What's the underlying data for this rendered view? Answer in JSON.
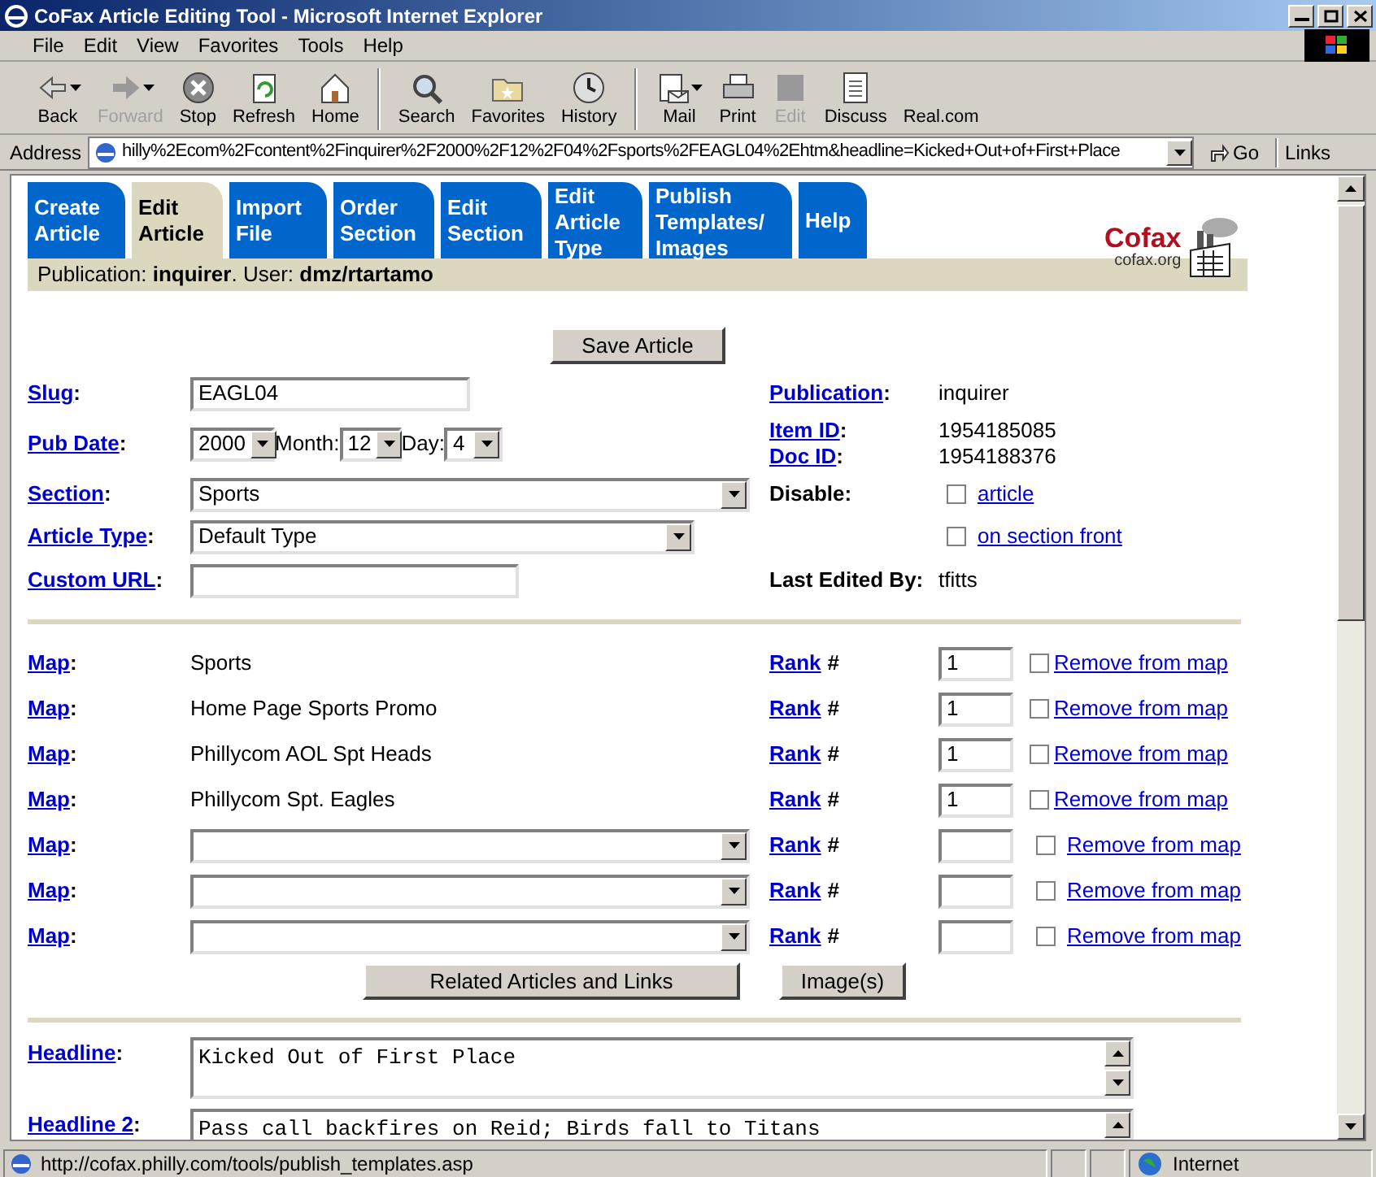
{
  "window": {
    "title": "CoFax Article Editing Tool - Microsoft Internet Explorer"
  },
  "menu": [
    "File",
    "Edit",
    "View",
    "Favorites",
    "Tools",
    "Help"
  ],
  "toolbar": [
    {
      "label": "Back",
      "disabled": false,
      "dropdown": true
    },
    {
      "label": "Forward",
      "disabled": true,
      "dropdown": true
    },
    {
      "label": "Stop",
      "disabled": false,
      "dropdown": false
    },
    {
      "label": "Refresh",
      "disabled": false,
      "dropdown": false
    },
    {
      "label": "Home",
      "disabled": false,
      "dropdown": false
    },
    {
      "label": "Search",
      "disabled": false,
      "dropdown": false
    },
    {
      "label": "Favorites",
      "disabled": false,
      "dropdown": false
    },
    {
      "label": "History",
      "disabled": false,
      "dropdown": false
    },
    {
      "label": "Mail",
      "disabled": false,
      "dropdown": true
    },
    {
      "label": "Print",
      "disabled": false,
      "dropdown": false
    },
    {
      "label": "Edit",
      "disabled": true,
      "dropdown": false
    },
    {
      "label": "Discuss",
      "disabled": false,
      "dropdown": false
    },
    {
      "label": "Real.com",
      "disabled": false,
      "dropdown": false
    }
  ],
  "address": {
    "label": "Address",
    "value": "hilly%2Ecom%2Fcontent%2Finquirer%2F2000%2F12%2F04%2Fsports%2FEAGL04%2Ehtm&headline=Kicked+Out+of+First+Place",
    "go": "Go",
    "links": "Links"
  },
  "tabs": [
    {
      "label": "Create Article",
      "selected": false
    },
    {
      "label": "Edit Article",
      "selected": true
    },
    {
      "label": "Import File",
      "selected": false
    },
    {
      "label": "Order Section",
      "selected": false
    },
    {
      "label": "Edit Section",
      "selected": false
    },
    {
      "label": "Edit Article Type",
      "selected": false
    },
    {
      "label": "Publish Templates/ Images",
      "selected": false
    },
    {
      "label": "Help",
      "selected": false
    }
  ],
  "info_bar": "Publication: **inquirer**. User: **dmz/rtartamo**",
  "logo": {
    "name": "Cofax",
    "site": "cofax.org"
  },
  "save_button": "Save Article",
  "slug": {
    "label": "Slug",
    "after": ":",
    "value": "EAGL04"
  },
  "pub_date": {
    "label": "Pub Date",
    "after": ":",
    "year": "2000",
    "month_label": "Month:",
    "month": "12",
    "day_label": "Day:",
    "day": "4"
  },
  "section": {
    "label": "Section",
    "after": ":",
    "value": "Sports"
  },
  "article_type": {
    "label": "Article Type",
    "after": ":",
    "value": "Default Type"
  },
  "custom_url": {
    "label": "Custom URL",
    "after": ":"
  },
  "publication": {
    "label": "Publication",
    "after": ":",
    "value": "inquirer"
  },
  "item_id": {
    "label": "Item ID",
    "after": ":",
    "value": "1954185085"
  },
  "doc_id": {
    "label": "Doc ID",
    "after": ":",
    "value": "1954188376"
  },
  "disable": {
    "label": "Disable:",
    "options": [
      {
        "label": "article",
        "checked": false
      },
      {
        "label": "on section front",
        "checked": false
      }
    ]
  },
  "last_edited": {
    "label": "Last Edited By:",
    "value": "tfitts"
  },
  "maps": [
    {
      "kind": "fixed",
      "label": "Map",
      "after": ":",
      "value": "Sports",
      "rank_label": "Rank",
      "rank_after": "#",
      "rank": "1",
      "remove": "Remove from map",
      "checked": false
    },
    {
      "kind": "fixed",
      "label": "Map",
      "after": ":",
      "value": "Home Page Sports Promo",
      "rank_label": "Rank",
      "rank_after": "#",
      "rank": "1",
      "remove": "Remove from map",
      "checked": false
    },
    {
      "kind": "fixed",
      "label": "Map",
      "after": ":",
      "value": "Phillycom AOL Spt Heads",
      "rank_label": "Rank",
      "rank_after": "#",
      "rank": "1",
      "remove": "Remove from map",
      "checked": false
    },
    {
      "kind": "fixed",
      "label": "Map",
      "after": ":",
      "value": "Phillycom Spt. Eagles",
      "rank_label": "Rank",
      "rank_after": "#",
      "rank": "1",
      "remove": "Remove from map",
      "checked": false
    },
    {
      "kind": "select",
      "label": "Map",
      "after": ":",
      "rank_label": "Rank",
      "rank_after": "#",
      "remove": "Remove from map",
      "checked": false
    },
    {
      "kind": "select",
      "label": "Map",
      "after": ":",
      "rank_label": "Rank",
      "rank_after": "#",
      "remove": "Remove from map",
      "checked": false
    },
    {
      "kind": "select",
      "label": "Map",
      "after": ":",
      "rank_label": "Rank",
      "rank_after": "#",
      "remove": "Remove from map",
      "checked": false
    }
  ],
  "related_button": "Related Articles and Links",
  "images_button": "Image(s)",
  "headlines": [
    {
      "label": "Headline",
      "after": ":",
      "value": "Kicked Out of First Place"
    },
    {
      "label": "Headline 2",
      "after": ":",
      "value": "Pass call backfires on Reid; Birds fall to Titans"
    }
  ],
  "status_bar": {
    "url": "http://cofax.philly.com/tools/publish_templates.asp",
    "zone": "Internet"
  }
}
